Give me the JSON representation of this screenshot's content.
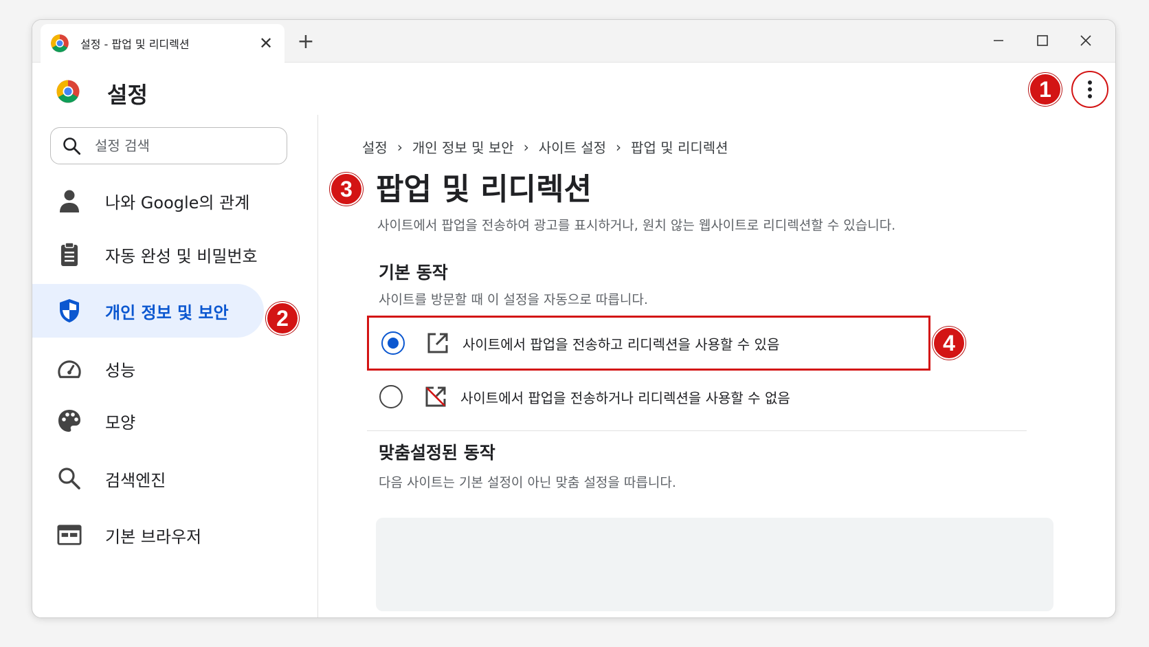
{
  "tab": {
    "title": "설정 - 팝업 및 리디렉션"
  },
  "header": {
    "title": "설정"
  },
  "search": {
    "placeholder": "설정 검색"
  },
  "sidebar": {
    "items": [
      {
        "label": "나와 Google의 관계",
        "icon": "person-icon"
      },
      {
        "label": "자동 완성 및 비밀번호",
        "icon": "clipboard-icon"
      },
      {
        "label": "개인 정보 및 보안",
        "icon": "shield-icon",
        "active": true
      },
      {
        "label": "성능",
        "icon": "speedometer-icon"
      },
      {
        "label": "모양",
        "icon": "palette-icon"
      },
      {
        "label": "검색엔진",
        "icon": "search-icon"
      },
      {
        "label": "기본 브라우저",
        "icon": "browser-icon"
      }
    ]
  },
  "breadcrumb": [
    "설정",
    "개인 정보 및 보안",
    "사이트 설정",
    "팝업 및 리디렉션"
  ],
  "main": {
    "title": "팝업 및 리디렉션",
    "description": "사이트에서 팝업을 전송하여 광고를 표시하거나, 원치 않는 웹사이트로 리디렉션할 수 있습니다.",
    "default_behavior": {
      "title": "기본 동작",
      "description": "사이트를 방문할 때 이 설정을 자동으로 따릅니다.",
      "options": [
        {
          "label": "사이트에서 팝업을 전송하고 리디렉션을 사용할 수 있음",
          "selected": true,
          "icon": "open-in-new-icon"
        },
        {
          "label": "사이트에서 팝업을 전송하거나 리디렉션을 사용할 수 없음",
          "selected": false,
          "icon": "open-in-new-off-icon"
        }
      ]
    },
    "custom_behavior": {
      "title": "맞춤설정된 동작",
      "description": "다음 사이트는 기본 설정이 아닌 맞춤 설정을 따릅니다."
    }
  },
  "annotations": [
    "1",
    "2",
    "3",
    "4"
  ],
  "colors": {
    "accent": "#0b57d0",
    "annotation": "#d31414",
    "active_bg": "#e8f0fe"
  }
}
